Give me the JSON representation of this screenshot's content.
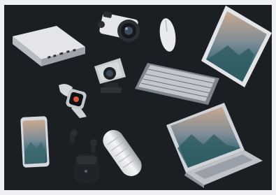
{
  "image": {
    "alt": "",
    "background_color": "#1b1f24",
    "frame_color": "#eef0f3",
    "objects": [
      {
        "name": "mac-mini-icon"
      },
      {
        "name": "mirrorless-camera-icon"
      },
      {
        "name": "wireless-mouse-icon"
      },
      {
        "name": "tablet-icon"
      },
      {
        "name": "action-camera-icon"
      },
      {
        "name": "keyboard-icon"
      },
      {
        "name": "smartwatch-icon"
      },
      {
        "name": "smartphone-icon"
      },
      {
        "name": "earbuds-case-icon"
      },
      {
        "name": "portable-speaker-icon"
      },
      {
        "name": "laptop-icon"
      }
    ]
  }
}
